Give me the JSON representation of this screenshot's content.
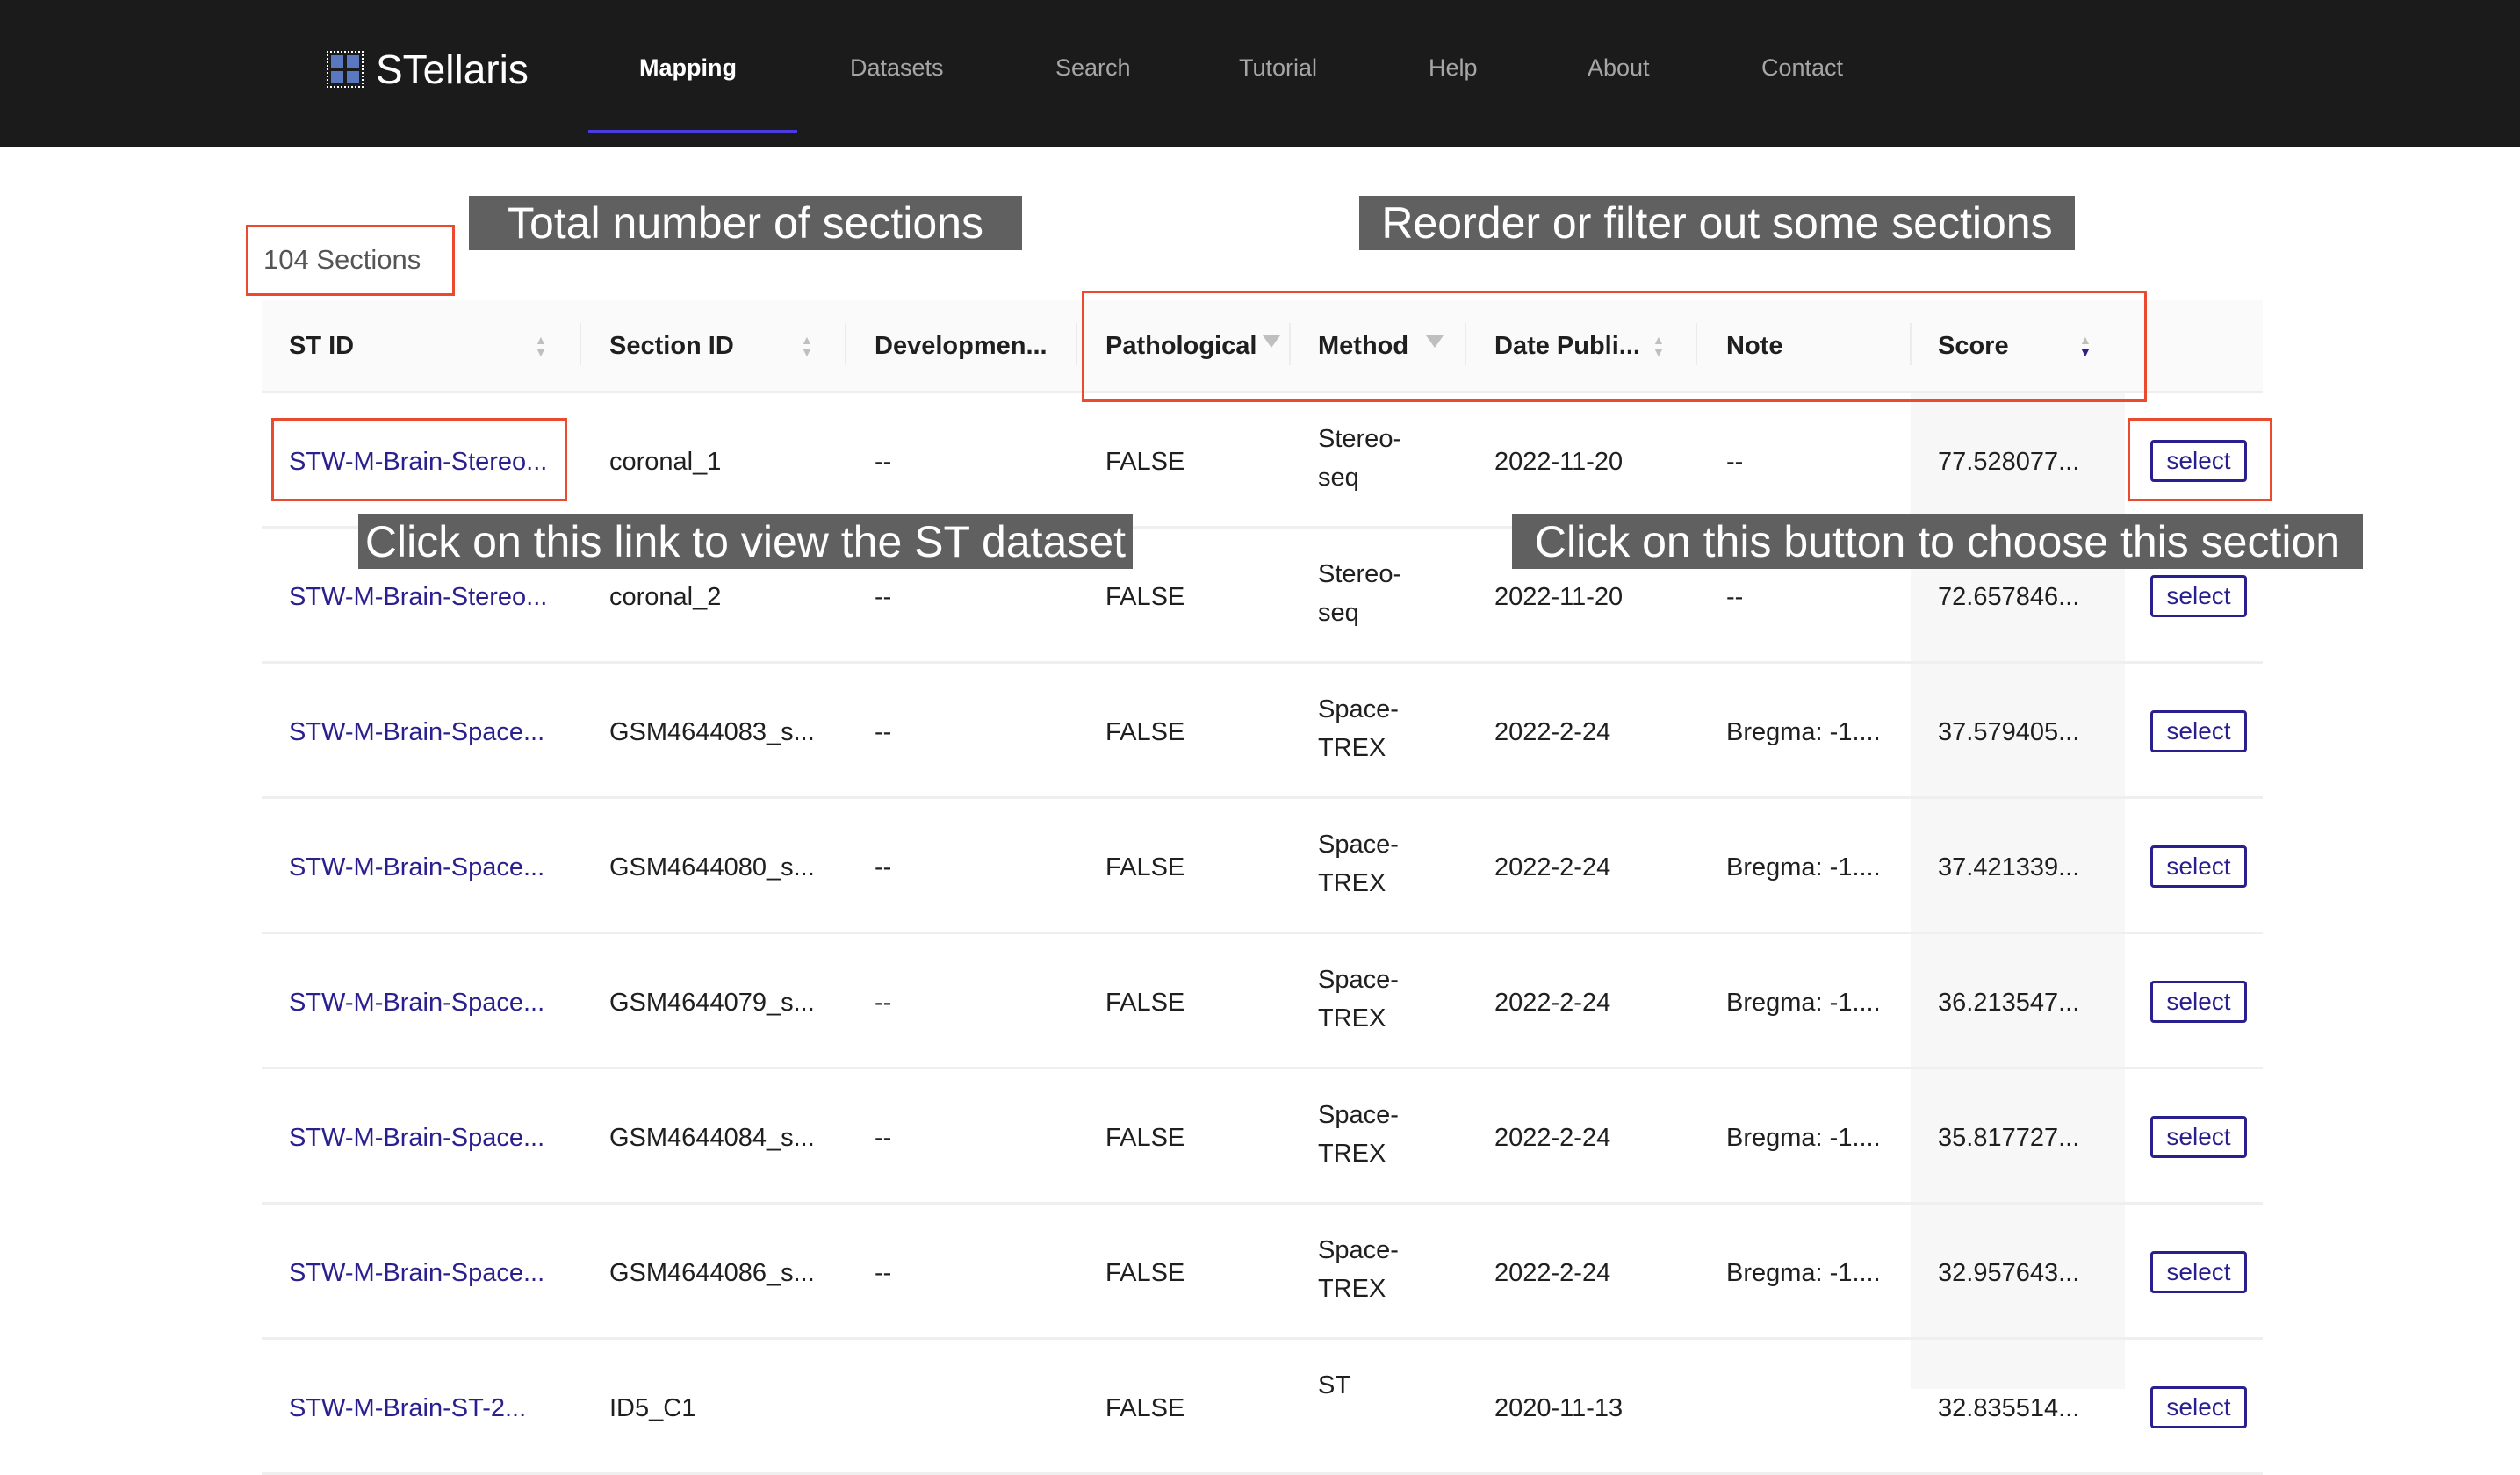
{
  "nav": {
    "brand": "STellaris",
    "items": [
      "Mapping",
      "Datasets",
      "Search",
      "Tutorial",
      "Help",
      "About",
      "Contact"
    ],
    "active": "Mapping",
    "accent": "#4a3be0"
  },
  "count": "104 Sections",
  "annotations": {
    "total": "Total number of sections",
    "reorder": "Reorder or filter out some sections",
    "link": "Click on this link to view the ST dataset",
    "button": "Click on this button to choose this section",
    "box_color": "#ec4a2f"
  },
  "table": {
    "columns": [
      "ST ID",
      "Section ID",
      "Developmen...",
      "Pathological",
      "Method",
      "Date Publi...",
      "Note",
      "Score"
    ],
    "sort": {
      "column": "Score",
      "direction": "descending"
    },
    "select_label": "select",
    "rows": [
      {
        "st_id": "STW-M-Brain-Stereo...",
        "section": "coronal_1",
        "dev": "--",
        "path": "FALSE",
        "method1": "Stereo-",
        "method2": "seq",
        "date": "2022-11-20",
        "note": "--",
        "score": "77.528077..."
      },
      {
        "st_id": "STW-M-Brain-Stereo...",
        "section": "coronal_2",
        "dev": "--",
        "path": "FALSE",
        "method1": "Stereo-",
        "method2": "seq",
        "date": "2022-11-20",
        "note": "--",
        "score": "72.657846..."
      },
      {
        "st_id": "STW-M-Brain-Space...",
        "section": "GSM4644083_s...",
        "dev": "--",
        "path": "FALSE",
        "method1": "Space-",
        "method2": "TREX",
        "date": "2022-2-24",
        "note": "Bregma: -1....",
        "score": "37.579405..."
      },
      {
        "st_id": "STW-M-Brain-Space...",
        "section": "GSM4644080_s...",
        "dev": "--",
        "path": "FALSE",
        "method1": "Space-",
        "method2": "TREX",
        "date": "2022-2-24",
        "note": "Bregma: -1....",
        "score": "37.421339..."
      },
      {
        "st_id": "STW-M-Brain-Space...",
        "section": "GSM4644079_s...",
        "dev": "--",
        "path": "FALSE",
        "method1": "Space-",
        "method2": "TREX",
        "date": "2022-2-24",
        "note": "Bregma: -1....",
        "score": "36.213547..."
      },
      {
        "st_id": "STW-M-Brain-Space...",
        "section": "GSM4644084_s...",
        "dev": "--",
        "path": "FALSE",
        "method1": "Space-",
        "method2": "TREX",
        "date": "2022-2-24",
        "note": "Bregma: -1....",
        "score": "35.817727..."
      },
      {
        "st_id": "STW-M-Brain-Space...",
        "section": "GSM4644086_s...",
        "dev": "--",
        "path": "FALSE",
        "method1": "Space-",
        "method2": "TREX",
        "date": "2022-2-24",
        "note": "Bregma: -1....",
        "score": "32.957643..."
      },
      {
        "st_id": "STW-M-Brain-ST-2...",
        "section": "ID5_C1",
        "dev": "",
        "path": "FALSE",
        "method1": "ST",
        "method2": "",
        "date": "2020-11-13",
        "note": "",
        "score": "32.835514..."
      }
    ]
  }
}
